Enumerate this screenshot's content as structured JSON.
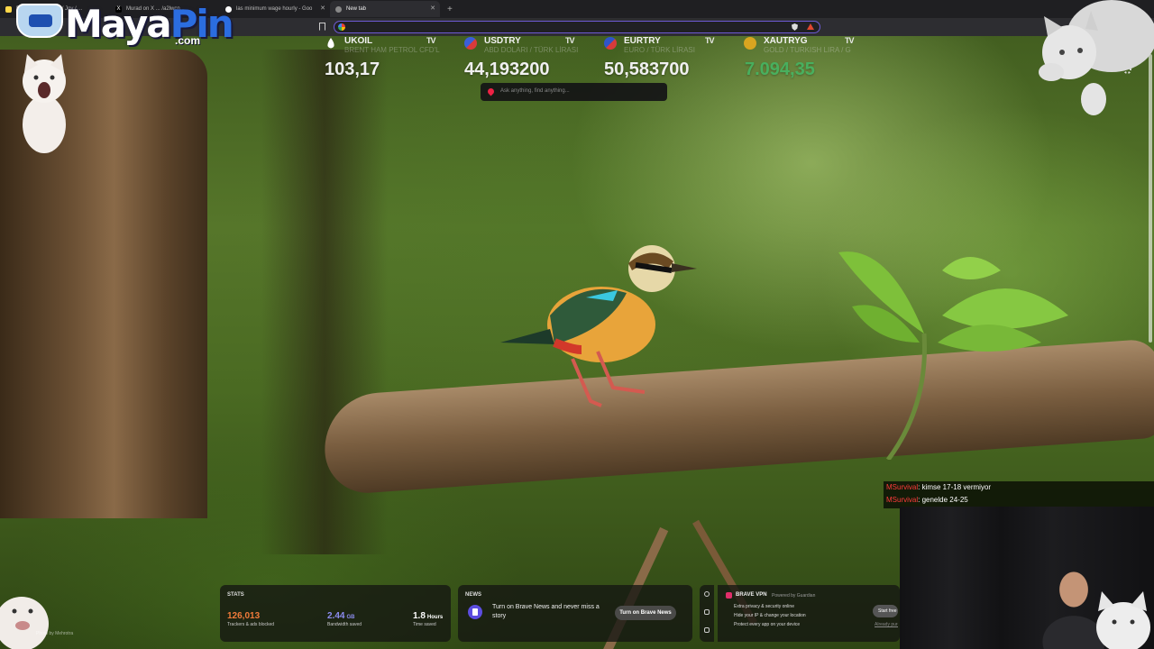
{
  "tabs": [
    {
      "label": "Bo... / Megane / ... / Joy / ...",
      "favicon": "streamlabs-icon"
    },
    {
      "label": "Murad on X ... /a2lwcn..."
    },
    {
      "label": "las minimum wage hourly - Goo",
      "favicon": "google-icon"
    },
    {
      "label": "New tab",
      "favicon": "brave-icon"
    }
  ],
  "ticker": [
    {
      "symbol": "UKOIL",
      "sub": "BRENT HAM PETROL CFD'L",
      "price": "103,17",
      "color": "#111111"
    },
    {
      "symbol": "USDTRY",
      "sub": "ABD DOLARI / TÜRK LİRASI",
      "price": "44,193200",
      "color": "#3b5fd8"
    },
    {
      "symbol": "EURTRY",
      "sub": "EURO / TÜRK LİRASI",
      "price": "50,583700",
      "color": "#2f55c8"
    },
    {
      "symbol": "XAUTRYG",
      "sub": "GOLD / TURKISH LIRA / G",
      "price": "7.094,35",
      "color": "#d8a520",
      "price_color": "#3fbf6a"
    }
  ],
  "tv_mark": "TV",
  "logo": {
    "word_a": "Maya",
    "word_b": "Pin",
    "tld": ".com"
  },
  "search_assistant": {
    "placeholder": "Ask anything, find anything..."
  },
  "chat": [
    {
      "user": "MSurvival",
      "message": ": kimse 17-18 vermiyor"
    },
    {
      "user": "MSurvival",
      "message": ": genelde 24-25"
    }
  ],
  "stats_widget": {
    "title": "STATS",
    "items": [
      {
        "value": "126,013",
        "unit": "",
        "label": "Trackers & ads blocked",
        "color": "#f07a3a"
      },
      {
        "value": "2.44",
        "unit": "GB",
        "label": "Bandwidth saved",
        "color": "#8c8cf0"
      },
      {
        "value": "1.8",
        "unit": "Hours",
        "label": "Time saved",
        "color": "#ffffff"
      }
    ]
  },
  "news_widget": {
    "title": "NEWS",
    "text": "Turn on Brave News and never miss a story",
    "button": "Turn on Brave News"
  },
  "vpn_widget": {
    "title": "BRAVE VPN",
    "powered": "Powered by Guardian",
    "features": [
      "Extra privacy & security online",
      "Hide your IP & change your location",
      "Protect every app on your device"
    ],
    "button": "Start free trial",
    "secondary": "Already purchased?"
  },
  "photo_credit": "Photo by Mehrotra"
}
